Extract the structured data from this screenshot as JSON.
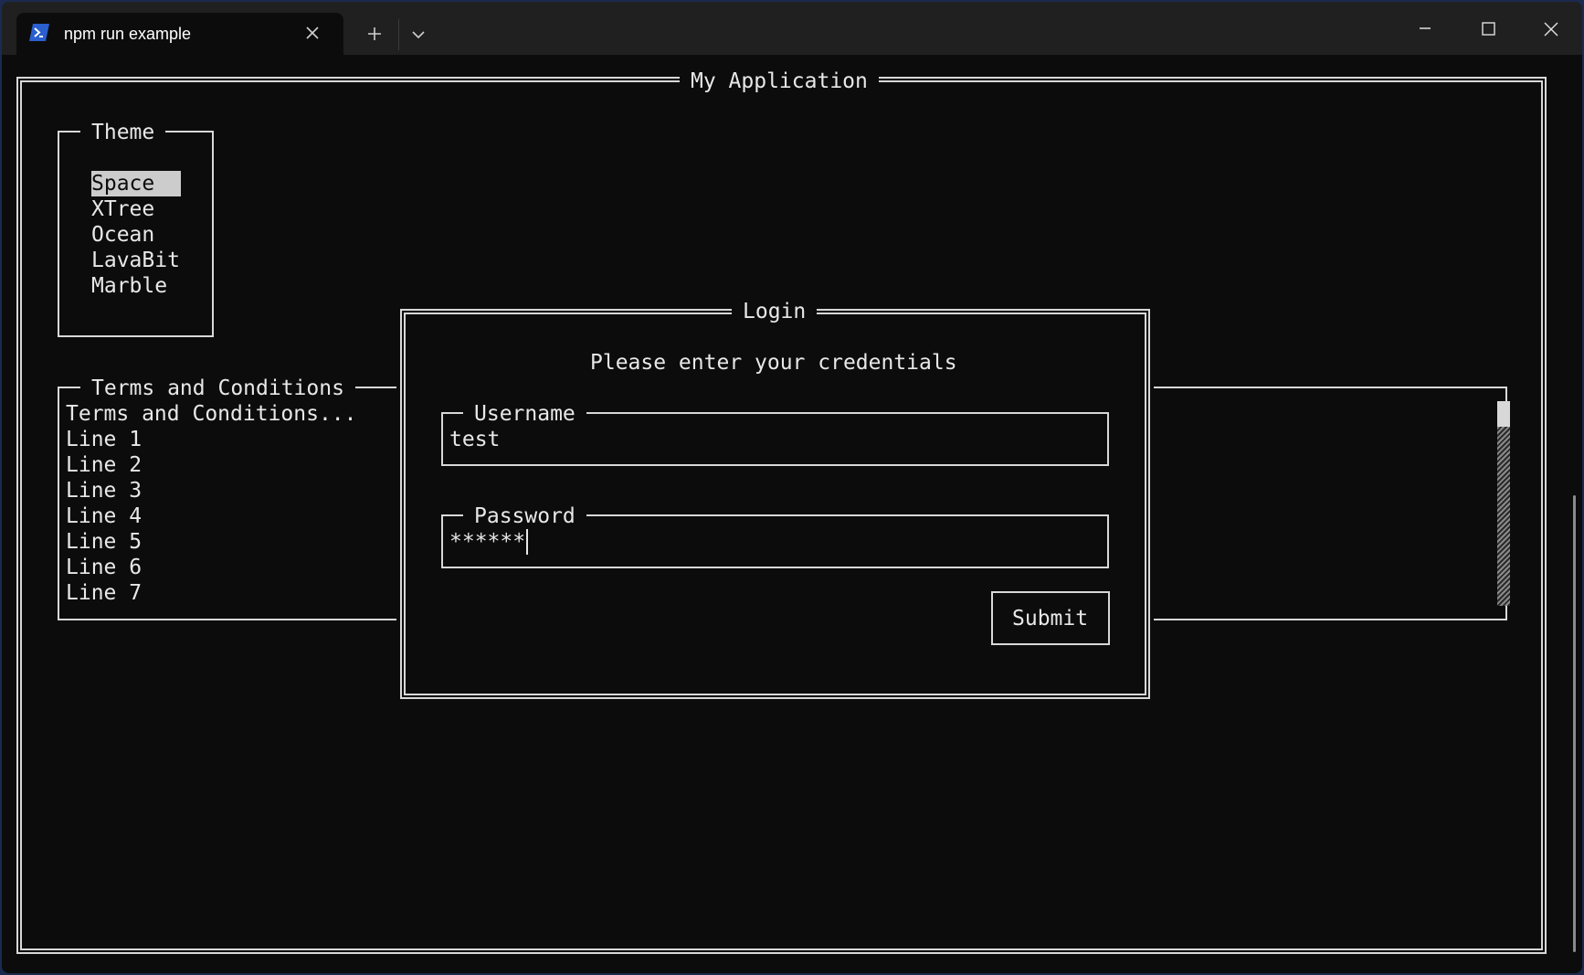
{
  "window": {
    "tab_title": "npm run example",
    "new_tab_icon": "plus-icon",
    "dropdown_icon": "chevron-down-icon",
    "controls": [
      "minimize-icon",
      "maximize-icon",
      "close-icon"
    ]
  },
  "app": {
    "title": "My Application"
  },
  "theme_panel": {
    "title": "Theme",
    "options": [
      "Space",
      "XTree",
      "Ocean",
      "LavaBit",
      "Marble"
    ],
    "selected": "Space"
  },
  "terms_panel": {
    "title": "Terms and Conditions",
    "lines": [
      "Terms and Conditions...",
      "Line 1",
      "Line 2",
      "Line 3",
      "Line 4",
      "Line 5",
      "Line 6",
      "Line 7"
    ]
  },
  "login": {
    "title": "Login",
    "prompt": "Please enter your credentials",
    "username_label": "Username",
    "username_value": "test",
    "password_label": "Password",
    "password_value": "******",
    "submit_label": "Submit"
  },
  "colors": {
    "terminal_bg": "#0c0c0c",
    "titlebar_bg": "#202020",
    "foreground": "#e8e8e8",
    "powershell_icon": "#2b5fce"
  }
}
